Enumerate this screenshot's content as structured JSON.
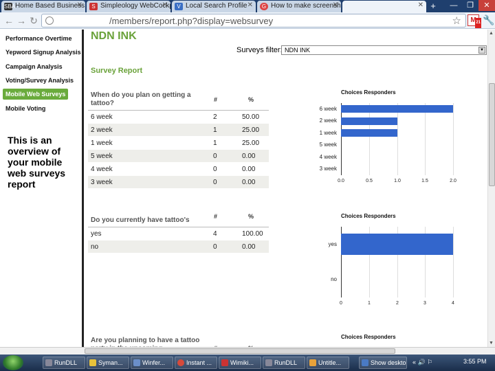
{
  "tabs": [
    {
      "label": "Home Based Business |",
      "favicon": "SBA"
    },
    {
      "label": "Simpleology WebCockp",
      "favicon": "S"
    },
    {
      "label": "Local Search Profile",
      "favicon": "V"
    },
    {
      "label": "How to make screensho",
      "favicon": "G"
    },
    {
      "label": "",
      "favicon": ""
    }
  ],
  "toolbar": {
    "url": "/members/report.php?display=websurvey",
    "gmail_badge": "21"
  },
  "sidebar": {
    "items": [
      {
        "label": "Performance Overtime"
      },
      {
        "label": "Yepword Signup Analysis"
      },
      {
        "label": "Campaign Analysis"
      },
      {
        "label": "Voting/Survey Analysis"
      },
      {
        "label": "Mobile Web Surveys"
      },
      {
        "label": "Mobile Voting"
      }
    ],
    "overview": "This is an overview of your mobile web surveys report"
  },
  "page": {
    "title": "NDN INK",
    "filter_label": "Surveys filter:",
    "filter_value": "NDN INK",
    "report_title": "Survey Report"
  },
  "colors": {
    "accent": "#6aa23a",
    "bar": "#3366cc"
  },
  "questions": [
    {
      "question": "When do you plan on getting a tattoo?",
      "col_count": "#",
      "col_pct": "%",
      "rows": [
        {
          "choice": "6 week",
          "count": "2",
          "pct": "50.00"
        },
        {
          "choice": "2 week",
          "count": "1",
          "pct": "25.00"
        },
        {
          "choice": "1 week",
          "count": "1",
          "pct": "25.00"
        },
        {
          "choice": "5 week",
          "count": "0",
          "pct": "0.00"
        },
        {
          "choice": "4 week",
          "count": "0",
          "pct": "0.00"
        },
        {
          "choice": "3 week",
          "count": "0",
          "pct": "0.00"
        }
      ]
    },
    {
      "question": "Do you currently have tattoo's",
      "col_count": "#",
      "col_pct": "%",
      "rows": [
        {
          "choice": "yes",
          "count": "4",
          "pct": "100.00"
        },
        {
          "choice": "no",
          "count": "0",
          "pct": "0.00"
        }
      ]
    },
    {
      "question": "Are you planning to have a tattoo party in the upcoming",
      "col_count": "#",
      "col_pct": "%",
      "rows": []
    }
  ],
  "chart_data": [
    {
      "type": "bar",
      "orientation": "horizontal",
      "title": "Choices Responders",
      "categories": [
        "6 week",
        "2 week",
        "1 week",
        "5 week",
        "4 week",
        "3 week"
      ],
      "values": [
        2,
        1,
        1,
        0,
        0,
        0
      ],
      "xlim": [
        0,
        2
      ],
      "ticks": [
        "0.0",
        "0.5",
        "1.0",
        "1.5",
        "2.0"
      ]
    },
    {
      "type": "bar",
      "orientation": "horizontal",
      "title": "Choices Responders",
      "categories": [
        "yes",
        "no"
      ],
      "values": [
        4,
        0
      ],
      "xlim": [
        0,
        4
      ],
      "ticks": [
        "0",
        "1",
        "2",
        "3",
        "4"
      ]
    },
    {
      "type": "bar",
      "orientation": "horizontal",
      "title": "Choices Responders",
      "categories": [],
      "values": []
    }
  ],
  "taskbar": {
    "items": [
      {
        "label": "RunDLL"
      },
      {
        "label": "Syman..."
      },
      {
        "label": "Winfer..."
      },
      {
        "label": "Instant ..."
      },
      {
        "label": "Wimiki..."
      },
      {
        "label": "RunDLL"
      },
      {
        "label": "Untitle..."
      },
      {
        "label": "Show desktop"
      }
    ],
    "clock": "3:55 PM"
  }
}
